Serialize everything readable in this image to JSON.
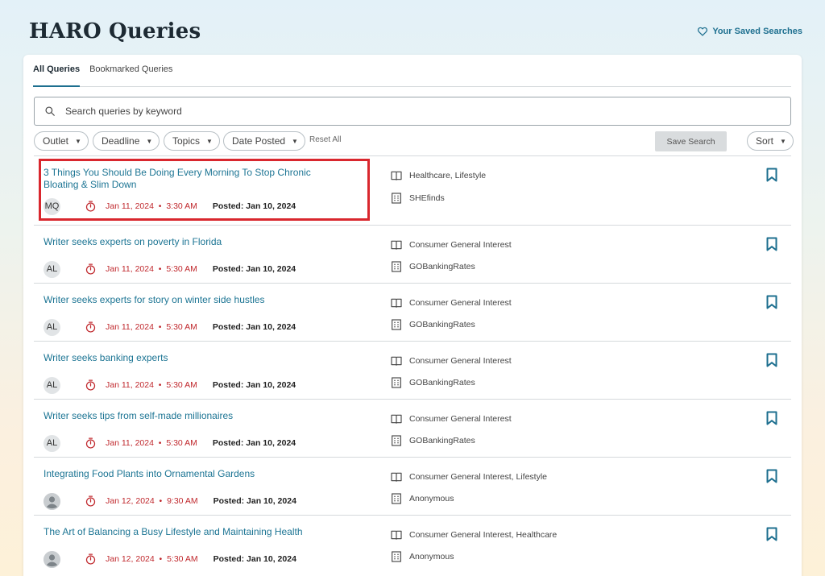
{
  "header": {
    "title": "HARO Queries",
    "saved_searches_label": "Your Saved Searches"
  },
  "tabs": [
    {
      "label": "All Queries",
      "active": true
    },
    {
      "label": "Bookmarked Queries",
      "active": false
    }
  ],
  "search": {
    "placeholder": "Search queries by keyword",
    "value": ""
  },
  "filters": {
    "outlet": "Outlet",
    "deadline": "Deadline",
    "topics": "Topics",
    "date_posted": "Date Posted",
    "reset_all": "Reset All",
    "save_search": "Save Search",
    "sort": "Sort"
  },
  "colors": {
    "accent": "#1d7594",
    "deadline_red": "#c0282d",
    "highlight_red": "#d9272e"
  },
  "queries": [
    {
      "title": "3 Things You Should Be Doing Every Morning To Stop Chronic Bloating & Slim Down",
      "initials": "MQ",
      "deadline_date": "Jan 11, 2024",
      "deadline_time": "3:30 AM",
      "posted": "Posted: Jan 10, 2024",
      "topics": "Healthcare, Lifestyle",
      "outlet": "SHEfinds",
      "highlighted": true
    },
    {
      "title": "Writer seeks experts on poverty in Florida",
      "initials": "AL",
      "deadline_date": "Jan 11, 2024",
      "deadline_time": "5:30 AM",
      "posted": "Posted: Jan 10, 2024",
      "topics": "Consumer General Interest",
      "outlet": "GOBankingRates"
    },
    {
      "title": "Writer seeks experts for story on winter side hustles",
      "initials": "AL",
      "deadline_date": "Jan 11, 2024",
      "deadline_time": "5:30 AM",
      "posted": "Posted: Jan 10, 2024",
      "topics": "Consumer General Interest",
      "outlet": "GOBankingRates"
    },
    {
      "title": "Writer seeks banking experts",
      "initials": "AL",
      "deadline_date": "Jan 11, 2024",
      "deadline_time": "5:30 AM",
      "posted": "Posted: Jan 10, 2024",
      "topics": "Consumer General Interest",
      "outlet": "GOBankingRates"
    },
    {
      "title": "Writer seeks tips from self-made millionaires",
      "initials": "AL",
      "deadline_date": "Jan 11, 2024",
      "deadline_time": "5:30 AM",
      "posted": "Posted: Jan 10, 2024",
      "topics": "Consumer General Interest",
      "outlet": "GOBankingRates"
    },
    {
      "title": "Integrating Food Plants into Ornamental Gardens",
      "initials": "",
      "avatar_icon": "person-icon",
      "deadline_date": "Jan 12, 2024",
      "deadline_time": "9:30 AM",
      "posted": "Posted: Jan 10, 2024",
      "topics": "Consumer General Interest, Lifestyle",
      "outlet": "Anonymous"
    },
    {
      "title": "The Art of Balancing a Busy Lifestyle and Maintaining Health",
      "initials": "",
      "avatar_icon": "person-icon",
      "deadline_date": "Jan 12, 2024",
      "deadline_time": "5:30 AM",
      "posted": "Posted: Jan 10, 2024",
      "topics": "Consumer General Interest, Healthcare",
      "outlet": "Anonymous"
    }
  ]
}
